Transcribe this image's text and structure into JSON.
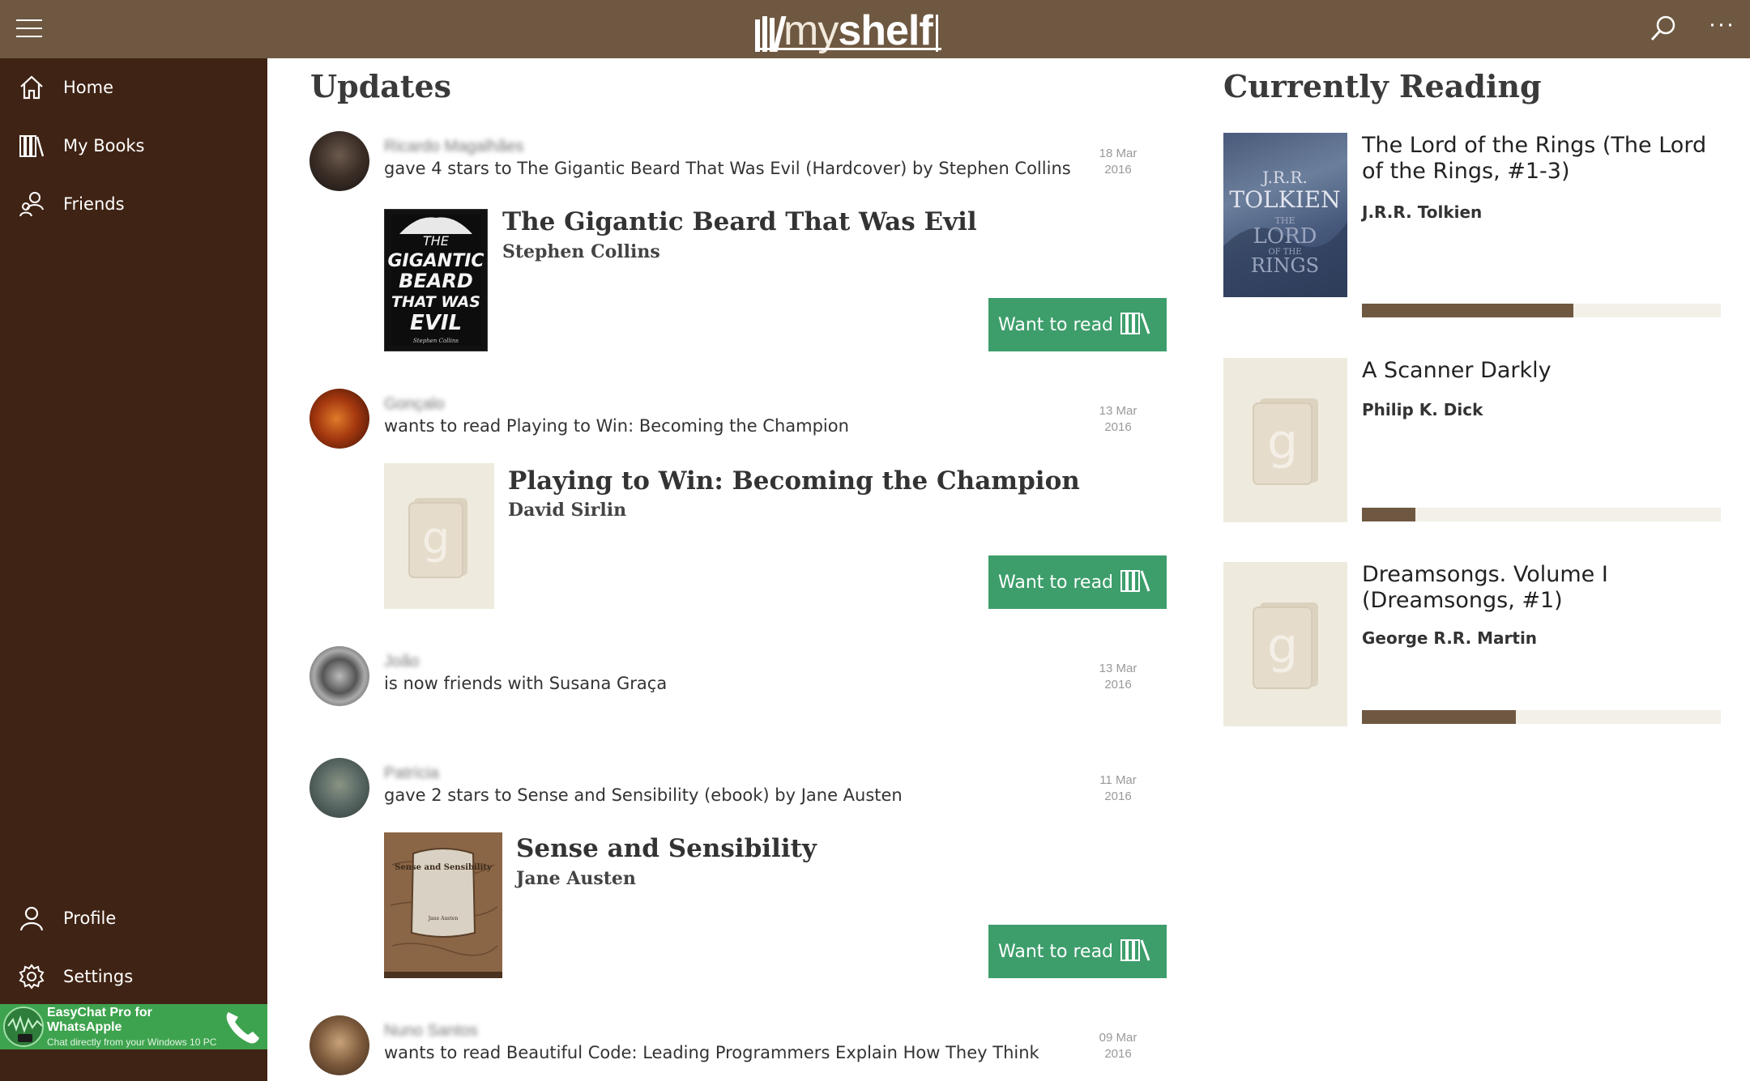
{
  "app": {
    "logo_my": "my",
    "logo_shelf": "shelf"
  },
  "nav": {
    "home": "Home",
    "my_books": "My Books",
    "friends": "Friends",
    "profile": "Profile",
    "settings": "Settings"
  },
  "promo": {
    "title": "EasyChat Pro for WhatsApple",
    "subtitle": "Chat directly from your Windows 10 PC"
  },
  "updates": {
    "heading": "Updates",
    "want_to_read_label": "Want to read",
    "items": [
      {
        "user": "Ricardo Magalhães",
        "text": "gave 4 stars to The Gigantic Beard That Was Evil (Hardcover) by Stephen    Collins",
        "date_day": "18 Mar",
        "date_year": "2016",
        "book_title": "The Gigantic Beard That Was Evil",
        "book_author": "Stephen    Collins",
        "cover_lines": [
          "THE",
          "GIGANTIC",
          "BEARD",
          "THAT WAS",
          "EVIL"
        ],
        "cover_credit": "Stephen Collins"
      },
      {
        "user": "Gonçalo",
        "text": "wants to read Playing to Win: Becoming the Champion",
        "date_day": "13 Mar",
        "date_year": "2016",
        "book_title": "Playing to Win: Becoming the Champion",
        "book_author": "David Sirlin"
      },
      {
        "user": "João",
        "text": "is now friends with Susana Graça",
        "date_day": "13 Mar",
        "date_year": "2016"
      },
      {
        "user": "Patrícia",
        "text": "gave 2 stars to Sense and Sensibility (ebook) by Jane Austen",
        "date_day": "11 Mar",
        "date_year": "2016",
        "book_title": "Sense and Sensibility",
        "book_author": "Jane Austen",
        "cover_title": "Sense and Sensibility",
        "cover_author": "Jane Austen"
      },
      {
        "user": "Nuno Santos",
        "text": "wants to read Beautiful Code: Leading Programmers Explain How They Think",
        "date_day": "09 Mar",
        "date_year": "2016"
      }
    ]
  },
  "currently_reading": {
    "heading": "Currently Reading",
    "items": [
      {
        "title": "The Lord of the Rings (The Lord of the Rings, #1-3)",
        "author": "J.R.R. Tolkien",
        "progress": 0.59,
        "cover_lines": [
          "J.R.R.",
          "TOLKIEN",
          "THE",
          "LORD",
          "OF THE",
          "RINGS"
        ]
      },
      {
        "title": "A Scanner Darkly",
        "author": "Philip K. Dick",
        "progress": 0.15
      },
      {
        "title": "Dreamsongs. Volume I (Dreamsongs, #1)",
        "author": "George R.R. Martin",
        "progress": 0.43
      }
    ]
  }
}
